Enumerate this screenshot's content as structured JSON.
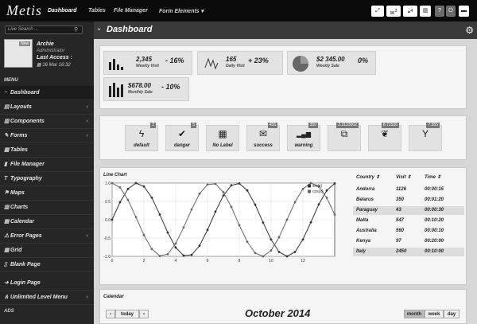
{
  "app": {
    "logo": "Metis"
  },
  "nav": {
    "items": [
      "Dashboard",
      "Tables",
      "File Manager",
      "Form Elements"
    ],
    "caret": "▾"
  },
  "toolbar": {
    "icons": [
      "expand-icon",
      "mail-icon",
      "comments-icon",
      "tasks-icon",
      "help-icon",
      "power-icon",
      "lock-icon",
      "chat-icon"
    ],
    "mail_badge": "3",
    "comments_badge": "4"
  },
  "sidebar": {
    "search_placeholder": "Live Search ...",
    "user": {
      "name": "Archie",
      "role": "Administrator",
      "access_label": "Last Access :",
      "date": "16 Mar 16:32",
      "avatar_tag": "New"
    },
    "menu_label": "MENU",
    "items": [
      {
        "label": "Dashboard",
        "icon": "dashboard-icon",
        "caret": false
      },
      {
        "label": "Layouts",
        "icon": "layouts-icon",
        "caret": true
      },
      {
        "label": "Components",
        "icon": "components-icon",
        "caret": true
      },
      {
        "label": "Forms",
        "icon": "forms-icon",
        "caret": true
      },
      {
        "label": "Tables",
        "icon": "tables-icon",
        "caret": false
      },
      {
        "label": "File Manager",
        "icon": "file-icon",
        "caret": false
      },
      {
        "label": "Typography",
        "icon": "typography-icon",
        "caret": false
      },
      {
        "label": "Maps",
        "icon": "map-icon",
        "caret": false
      },
      {
        "label": "Charts",
        "icon": "charts-icon",
        "caret": false
      },
      {
        "label": "Calendar",
        "icon": "calendar-icon",
        "caret": false
      },
      {
        "label": "Error Pages",
        "icon": "warning-icon",
        "caret": true
      },
      {
        "label": "Grid",
        "icon": "grid-icon",
        "caret": false
      },
      {
        "label": "Blank Page",
        "icon": "blank-icon",
        "caret": false
      },
      {
        "label": "Login Page",
        "icon": "login-icon",
        "caret": false
      },
      {
        "label": "Unlimited Level Menu",
        "icon": "sitemap-icon",
        "caret": true
      }
    ],
    "ads": "ADS"
  },
  "header": {
    "title": "Dashboard"
  },
  "stats": [
    {
      "value": "2,345",
      "label": "Weekly Visit",
      "percent": "- 16%"
    },
    {
      "value": "165",
      "label": "Daily Visit",
      "percent": "+ 23%"
    },
    {
      "value": "$2 345.00",
      "label": "Weekly Sale",
      "percent": "0%"
    },
    {
      "value": "$678.00",
      "label": "Monthly Sale",
      "percent": "- 10%"
    }
  ],
  "quick_buttons": [
    {
      "label": "default",
      "badge": "2",
      "icon": "bolt-icon",
      "glyph": "ϟ"
    },
    {
      "label": "danger",
      "badge": "5",
      "icon": "check-icon",
      "glyph": "✔"
    },
    {
      "label": "No Label",
      "badge": "",
      "icon": "building-icon",
      "glyph": "▦"
    },
    {
      "label": "success",
      "badge": "456",
      "icon": "envelope-icon",
      "glyph": "✉"
    },
    {
      "label": "warning",
      "badge": "350",
      "icon": "signal-icon",
      "glyph": "▂▄▆"
    },
    {
      "label": "",
      "badge": "2.3123002",
      "icon": "external-link-icon",
      "glyph": "⧉"
    },
    {
      "label": "",
      "badge": "8.71536",
      "icon": "leaf-icon",
      "glyph": "❦"
    },
    {
      "label": "",
      "badge": "7.555",
      "icon": "filter-icon",
      "glyph": "Y"
    }
  ],
  "chart_data": {
    "type": "line",
    "title": "Line Chart",
    "xlim": [
      0,
      14
    ],
    "ylim": [
      -1.0,
      1.0
    ],
    "xticks": [
      0,
      2,
      4,
      6,
      8,
      10,
      12
    ],
    "yticks": [
      1.0,
      0.5,
      0.0,
      -0.5,
      -1.0
    ],
    "legend_position": "top-right",
    "series": [
      {
        "name": "sin(x)",
        "x": [
          0,
          0.5,
          1,
          1.5,
          2,
          2.5,
          3,
          3.5,
          4,
          4.5,
          5,
          5.5,
          6,
          6.5,
          7,
          7.5,
          8,
          8.5,
          9,
          9.5,
          10,
          10.5,
          11,
          11.5,
          12,
          12.5,
          13,
          13.5,
          14
        ],
        "y": [
          0.0,
          0.48,
          0.84,
          1.0,
          0.91,
          0.6,
          0.14,
          -0.35,
          -0.76,
          -0.98,
          -0.96,
          -0.71,
          -0.28,
          0.22,
          0.66,
          0.94,
          0.99,
          0.8,
          0.41,
          -0.08,
          -0.54,
          -0.88,
          -1.0,
          -0.88,
          -0.54,
          -0.07,
          0.42,
          0.8,
          0.99
        ]
      },
      {
        "name": "cos(x)",
        "x": [
          0,
          0.5,
          1,
          1.5,
          2,
          2.5,
          3,
          3.5,
          4,
          4.5,
          5,
          5.5,
          6,
          6.5,
          7,
          7.5,
          8,
          8.5,
          9,
          9.5,
          10,
          10.5,
          11,
          11.5,
          12,
          12.5,
          13,
          13.5,
          14
        ],
        "y": [
          1.0,
          0.88,
          0.54,
          0.07,
          -0.42,
          -0.8,
          -0.99,
          -0.94,
          -0.65,
          -0.21,
          0.28,
          0.71,
          0.96,
          0.98,
          0.75,
          0.35,
          -0.15,
          -0.6,
          -0.91,
          -1.0,
          -0.84,
          -0.48,
          0.0,
          0.48,
          0.84,
          1.0,
          0.91,
          0.6,
          0.14
        ]
      }
    ]
  },
  "visits_table": {
    "headers": [
      "Country ⇕",
      "Visit ⇕",
      "Time ⇕"
    ],
    "rows": [
      [
        "Andorra",
        "1126",
        "00:00:15"
      ],
      [
        "Belarus",
        "350",
        "00:01:20"
      ],
      [
        "Paraguay",
        "43",
        "00:00:30"
      ],
      [
        "Malta",
        "547",
        "00:10:20"
      ],
      [
        "Australia",
        "560",
        "00:00:10"
      ],
      [
        "Kenya",
        "97",
        "00:20:00"
      ],
      [
        "Italy",
        "2450",
        "00:10:00"
      ]
    ]
  },
  "calendar": {
    "label": "Calendar",
    "title": "October 2014",
    "prev": "‹",
    "today": "today",
    "next": "›",
    "views": [
      "month",
      "week",
      "day"
    ]
  }
}
